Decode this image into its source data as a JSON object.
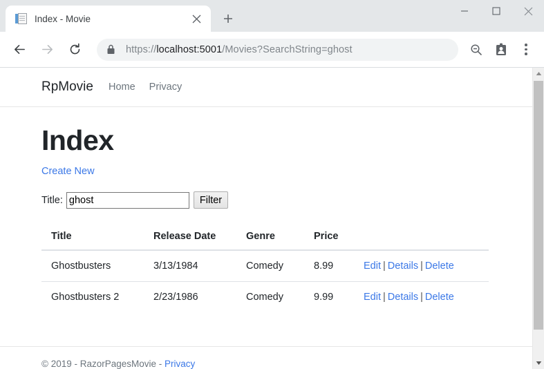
{
  "browser": {
    "tab": {
      "title": "Index - Movie",
      "favicon_name": "document-favicon",
      "close_label": "Close tab"
    },
    "new_tab_label": "New tab",
    "window_controls": {
      "minimize": "Minimize",
      "maximize": "Maximize",
      "close": "Close"
    },
    "toolbar": {
      "back": "Back",
      "forward": "Forward",
      "reload": "Reload",
      "lock_icon": "lock-icon",
      "url_scheme": "https://",
      "url_host": "localhost:5001",
      "url_path": "/Movies?SearchString=ghost",
      "zoom_out_icon": "zoom-out-icon",
      "profile_icon": "profile-badge-icon",
      "menu_icon": "three-dot-menu-icon"
    },
    "colors": {
      "tabstrip_bg": "#e4e7e9",
      "omnibox_bg": "#f1f3f4",
      "link": "#3b78e7"
    }
  },
  "site": {
    "brand": "RpMovie",
    "nav": [
      {
        "label": "Home"
      },
      {
        "label": "Privacy"
      }
    ],
    "page_title": "Index",
    "create_new_label": "Create New",
    "filter": {
      "label": "Title:",
      "value": "ghost",
      "placeholder": "",
      "button_label": "Filter"
    },
    "table": {
      "columns": [
        "Title",
        "Release Date",
        "Genre",
        "Price"
      ],
      "rows": [
        {
          "title": "Ghostbusters",
          "release_date": "3/13/1984",
          "genre": "Comedy",
          "price": "8.99",
          "actions": {
            "edit": "Edit",
            "details": "Details",
            "delete": "Delete"
          }
        },
        {
          "title": "Ghostbusters 2",
          "release_date": "2/23/1986",
          "genre": "Comedy",
          "price": "9.99",
          "actions": {
            "edit": "Edit",
            "details": "Details",
            "delete": "Delete"
          }
        }
      ],
      "action_separator": "|"
    },
    "footer": {
      "copyright": "© 2019 - RazorPagesMovie - ",
      "privacy_label": "Privacy"
    }
  }
}
